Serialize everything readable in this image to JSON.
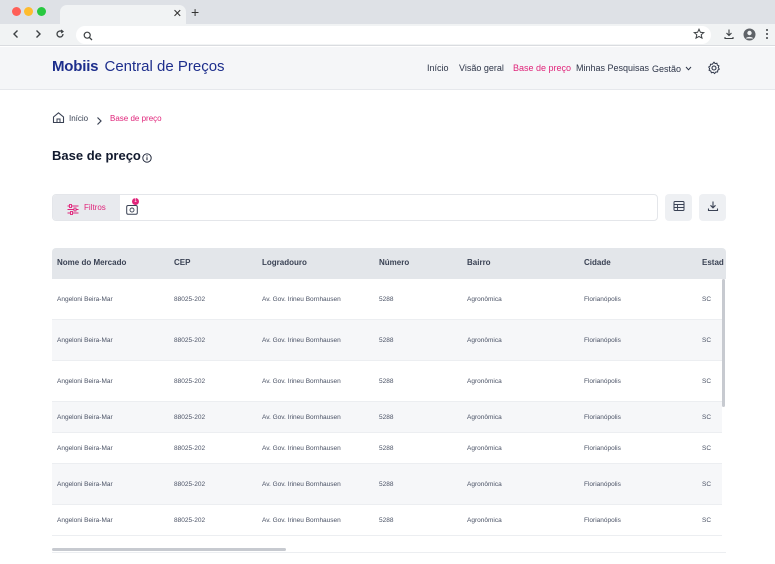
{
  "app": {
    "brand": "Mobiis",
    "product": "Central de Preços"
  },
  "nav": {
    "items": [
      {
        "label": "Início"
      },
      {
        "label": "Visão geral"
      },
      {
        "label": "Base de preço"
      },
      {
        "label": "Minhas Pesquisas"
      },
      {
        "label": "Gestão"
      }
    ],
    "active": "Base de preço",
    "accent_color": "#e0247a",
    "brand_color": "#1d2e8c"
  },
  "breadcrumb": {
    "items": [
      "Início",
      "Base de preço"
    ]
  },
  "page": {
    "title": "Base de preço"
  },
  "toolbar": {
    "filter_label": "Filtros",
    "badge_count": "1"
  },
  "table": {
    "columns": [
      "Nome do Mercado",
      "CEP",
      "Logradouro",
      "Número",
      "Bairro",
      "Cidade",
      "Estad"
    ],
    "rows": [
      [
        "Angeloni Beira-Mar",
        "88025-202",
        "Av. Gov. Irineu Bornhausen",
        "5288",
        "Agronômica",
        "Florianópolis",
        "SC"
      ],
      [
        "Angeloni Beira-Mar",
        "88025-202",
        "Av. Gov. Irineu Bornhausen",
        "5288",
        "Agronômica",
        "Florianópolis",
        "SC"
      ],
      [
        "Angeloni Beira-Mar",
        "88025-202",
        "Av. Gov. Irineu Bornhausen",
        "5288",
        "Agronômica",
        "Florianópolis",
        "SC"
      ],
      [
        "Angeloni Beira-Mar",
        "88025-202",
        "Av. Gov. Irineu Bornhausen",
        "5288",
        "Agronômica",
        "Florianópolis",
        "SC"
      ],
      [
        "Angeloni Beira-Mar",
        "88025-202",
        "Av. Gov. Irineu Bornhausen",
        "5288",
        "Agronômica",
        "Florianópolis",
        "SC"
      ],
      [
        "Angeloni Beira-Mar",
        "88025-202",
        "Av. Gov. Irineu Bornhausen",
        "5288",
        "Agronômica",
        "Florianópolis",
        "SC"
      ],
      [
        "Angeloni Beira-Mar",
        "88025-202",
        "Av. Gov. Irineu Bornhausen",
        "5288",
        "Agronômica",
        "Florianópolis",
        "SC"
      ]
    ]
  }
}
